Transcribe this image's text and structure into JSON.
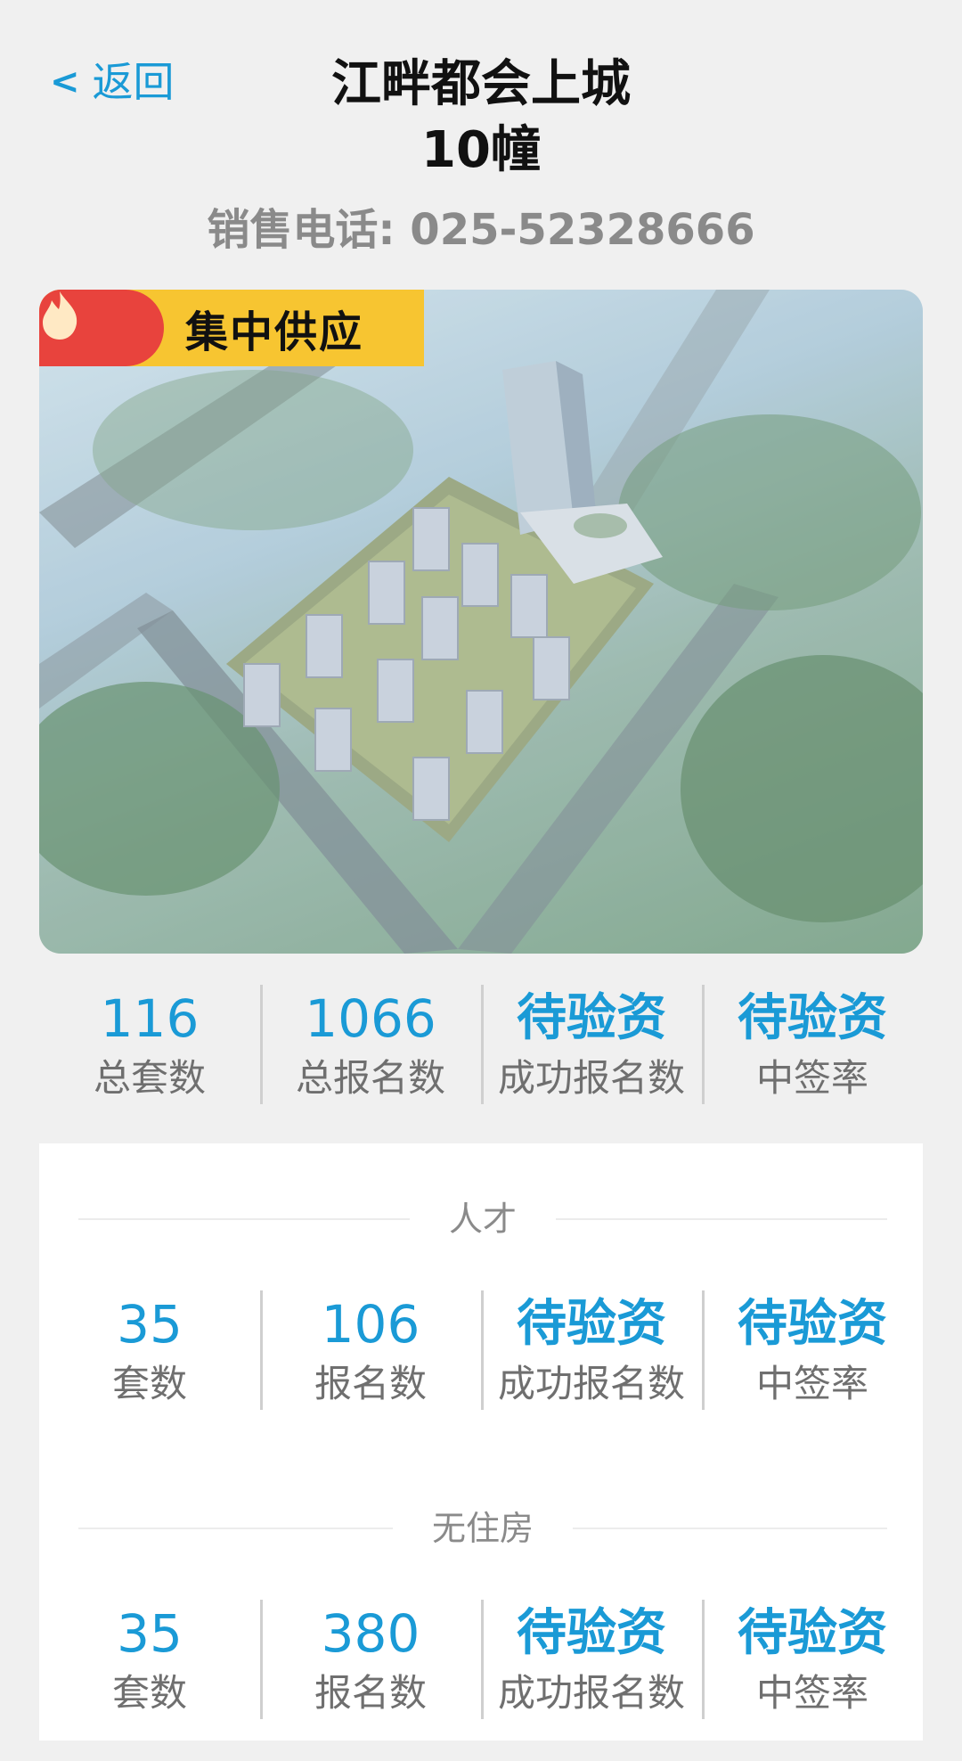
{
  "header": {
    "back_label": "返回",
    "back_chevron": "<",
    "title_line1": "江畔都会上城",
    "title_line2": "10幢",
    "phone": "销售电话: 025-52328666"
  },
  "hero": {
    "badge_text": "集中供应",
    "badge_icon": "flame-icon",
    "colors": {
      "badge_bg": "#f7c531",
      "badge_icon_bg": "#e8433d"
    }
  },
  "summary": [
    {
      "value": "116",
      "label": "总套数"
    },
    {
      "value": "1066",
      "label": "总报名数"
    },
    {
      "value": "待验资",
      "label": "成功报名数"
    },
    {
      "value": "待验资",
      "label": "中签率"
    }
  ],
  "groups": [
    {
      "title": "人才",
      "stats": [
        {
          "value": "35",
          "label": "套数"
        },
        {
          "value": "106",
          "label": "报名数"
        },
        {
          "value": "待验资",
          "label": "成功报名数"
        },
        {
          "value": "待验资",
          "label": "中签率"
        }
      ]
    },
    {
      "title": "无住房",
      "stats": [
        {
          "value": "35",
          "label": "套数"
        },
        {
          "value": "380",
          "label": "报名数"
        },
        {
          "value": "待验资",
          "label": "成功报名数"
        },
        {
          "value": "待验资",
          "label": "中签率"
        }
      ]
    }
  ],
  "colors": {
    "accent": "#1a9ad6",
    "label": "#6f6f6f",
    "background": "#f0f0f0"
  }
}
